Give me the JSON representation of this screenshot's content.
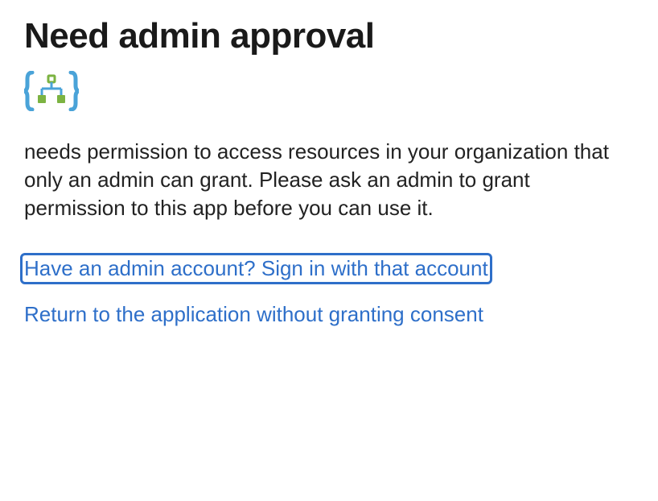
{
  "title": "Need admin approval",
  "description": "needs permission to access resources in your organization that only an admin can grant. Please ask an admin to grant permission to this app before you can use it.",
  "links": {
    "admin_signin": "Have an admin account? Sign in with that account",
    "return_no_consent": "Return to the application without granting consent"
  }
}
